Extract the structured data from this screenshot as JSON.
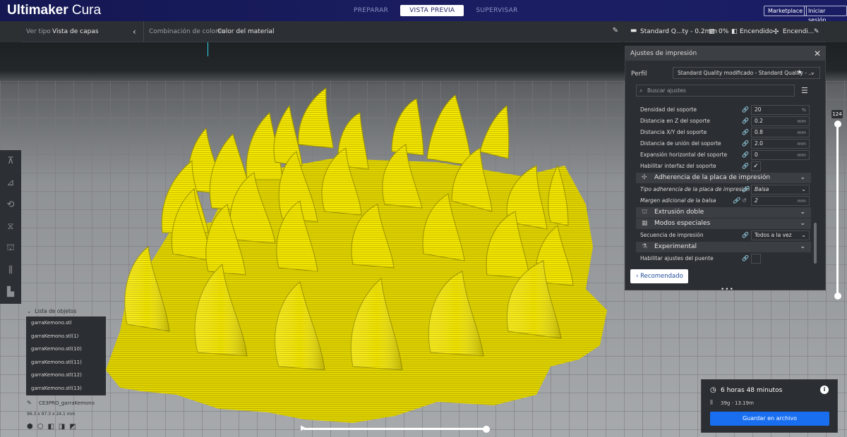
{
  "app": {
    "name_bold": "Ultimaker",
    "name_light": "Cura"
  },
  "stages": [
    {
      "label": "PREPARAR",
      "active": false
    },
    {
      "label": "VISTA PREVIA",
      "active": true
    },
    {
      "label": "SUPERVISAR",
      "active": false
    }
  ],
  "header_buttons": {
    "marketplace": "Marketplace",
    "login": "Iniciar sesión"
  },
  "view_bar": {
    "view_type_label": "Ver tipo",
    "view_type_value": "Vista de capas",
    "color_scheme_label": "Combinación de colores",
    "color_scheme_value": "Color del material"
  },
  "print_setup_bar": {
    "profile": "Standard Q...ty - 0.2mm",
    "infill": "0%",
    "support": "Encendido",
    "adhesion": "Encendi..."
  },
  "settings_panel": {
    "title": "Ajustes de impresión",
    "profile_label": "Perfil",
    "profile_value": "Standard Quality modificado - Standard Quality - ...",
    "search_placeholder": "Buscar ajustes",
    "rows": [
      {
        "label": "Densidad del soporte",
        "value": "20",
        "unit": "%"
      },
      {
        "label": "Distancia en Z del soporte",
        "value": "0.2",
        "unit": "mm"
      },
      {
        "label": "Distancia X/Y del soporte",
        "value": "0.8",
        "unit": "mm"
      },
      {
        "label": "Distancia de unión del soporte",
        "value": "2.0",
        "unit": "mm"
      },
      {
        "label": "Expansión horizontal del soporte",
        "value": "0",
        "unit": "mm"
      },
      {
        "label": "Habilitar interfaz del soporte",
        "checked": true
      }
    ],
    "cat_adhesion": "Adherencia de la placa de impresión",
    "adhesion_rows": [
      {
        "label": "Tipo adherencia de la placa de impresión",
        "value": "Balsa"
      },
      {
        "label": "Margen adicional de la balsa",
        "value": "2",
        "unit": "mm"
      }
    ],
    "cat_dual": "Extrusión doble",
    "cat_special": "Modos especiales",
    "special_rows": [
      {
        "label": "Secuencia de impresión",
        "value": "Todos a la vez"
      }
    ],
    "cat_experimental": "Experimental",
    "experimental_rows": [
      {
        "label": "Habilitar ajustes del puente",
        "checked": false
      }
    ],
    "recommended_button": "Recomendado"
  },
  "layer_slider": {
    "current_layer": "124"
  },
  "object_list": {
    "title": "Lista de objetos",
    "items": [
      "garraKemono.stl",
      "garraKemono.stl(1)",
      "garraKemono.stl(10)",
      "garraKemono.stl(11)",
      "garraKemono.stl(12)",
      "garraKemono.stl(13)"
    ],
    "job_name": "CE3PRO_garraKemono",
    "dimensions": "96.3 x 97.3 x 24.1 mm"
  },
  "print_info": {
    "time": "6 horas 48 minutos",
    "material": "39g · 13.19m",
    "save_button": "Guardar en archivo"
  },
  "colors": {
    "header_bg": "#1b1e62",
    "accent_blue": "#196ef0",
    "model_yellow": "#f2e400",
    "panel_bg": "#2b2e32"
  }
}
